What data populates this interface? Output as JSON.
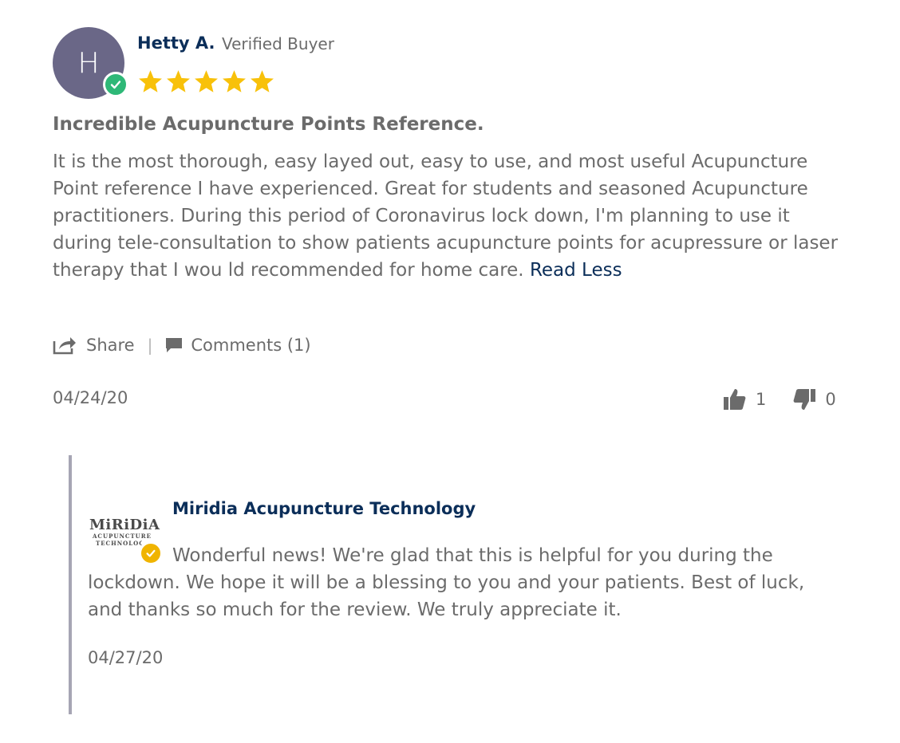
{
  "review": {
    "avatar_letter": "H",
    "author": "Hetty A.",
    "verified_label": "Verified Buyer",
    "rating": 5,
    "rating_max": 5,
    "title": "Incredible Acupuncture Points Reference.",
    "body": "It is the most thorough, easy layed out, easy to use, and most useful Acupuncture Point reference I have experienced. Great for students and seasoned Acupuncture practitioners. During this period of Coronavirus lock down, I'm planning to use it during tele-consultation to show patients acupuncture points for acupressure or laser therapy that I wou ld recommended for home care.",
    "read_less_label": "Read Less",
    "share_label": "Share",
    "separator": "|",
    "comments_label": "Comments (1)",
    "date": "04/24/20",
    "thumbs_up_count": "1",
    "thumbs_down_count": "0"
  },
  "reply": {
    "author": "Miridia Acupuncture Technology",
    "logo_text": "MiRiDiA",
    "logo_subtext_1": "ACUPUNCTURE",
    "logo_subtext_2": "TECHNOLOGY",
    "text": "Wonderful news! We're glad that this is helpful for you during the lockdown. We hope it will be a blessing to you and your patients. Best of luck, and thanks so much for the review. We truly appreciate it.",
    "date": "04/27/20"
  },
  "colors": {
    "brand_navy": "#0b2e59",
    "text_gray": "#6b6b6b",
    "star_yellow": "#f8c10a",
    "verified_green": "#2eb877",
    "verified_gold": "#f0b400",
    "avatar_bg": "#6a6787",
    "reply_bar": "#a6a5b4"
  },
  "icons": {
    "avatar_badge": "check-circle-icon",
    "star": "star-icon",
    "share": "share-icon",
    "comments": "comment-icon",
    "thumbs_up": "thumbs-up-icon",
    "thumbs_down": "thumbs-down-icon",
    "reply_badge": "check-circle-icon"
  }
}
